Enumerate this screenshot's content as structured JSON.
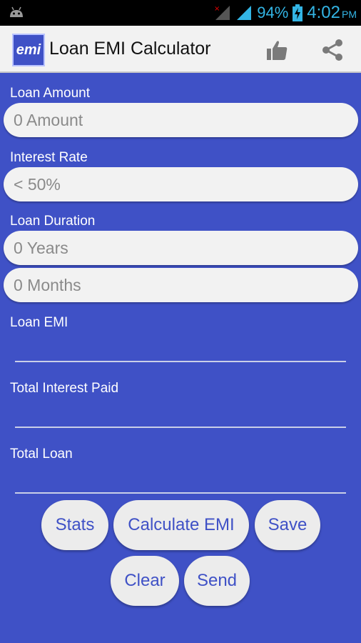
{
  "status_bar": {
    "battery_percent": "94%",
    "time": "4:02",
    "ampm": "PM",
    "accent_color": "#33b5e5"
  },
  "action_bar": {
    "logo_text": "emi",
    "title": "Loan EMI Calculator",
    "icons": [
      "thumbs-up-icon",
      "share-icon"
    ]
  },
  "form": {
    "loan_amount": {
      "label": "Loan Amount",
      "placeholder": "0 Amount"
    },
    "interest_rate": {
      "label": "Interest Rate",
      "placeholder": "< 50%"
    },
    "loan_duration": {
      "label": "Loan Duration",
      "years_placeholder": "0 Years",
      "months_placeholder": "0 Months"
    },
    "loan_emi": {
      "label": "Loan EMI",
      "value": ""
    },
    "total_interest": {
      "label": "Total Interest Paid",
      "value": ""
    },
    "total_loan": {
      "label": "Total Loan",
      "value": ""
    }
  },
  "buttons": {
    "stats": "Stats",
    "calculate": "Calculate EMI",
    "save": "Save",
    "clear": "Clear",
    "send": "Send"
  },
  "colors": {
    "background": "#3f51c6",
    "field_bg": "#f2f2f2",
    "button_text": "#3f51c6"
  }
}
